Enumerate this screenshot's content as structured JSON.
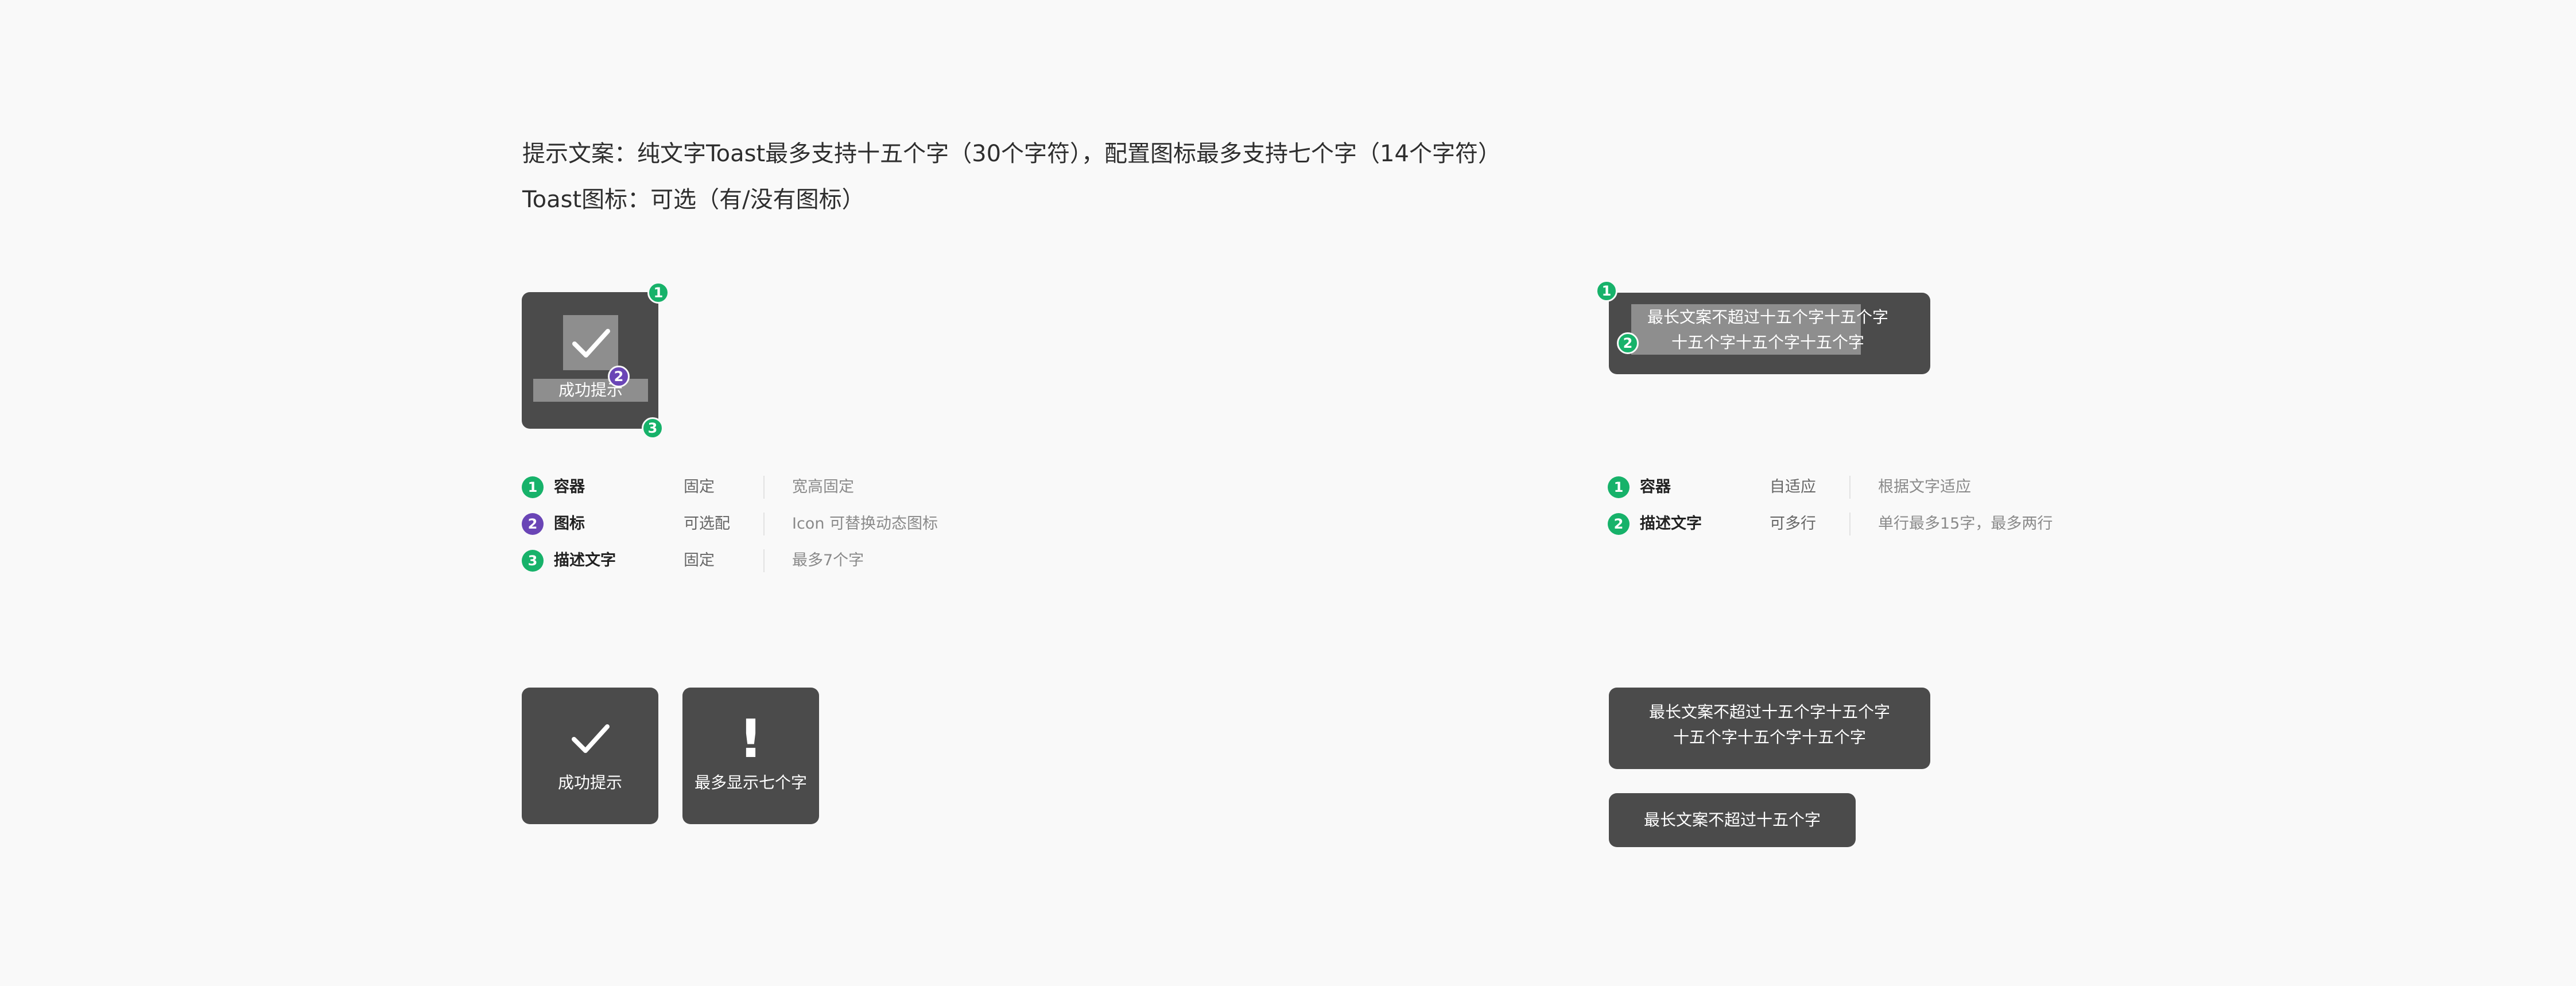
{
  "header": {
    "line1": "提示文案：纯文字Toast最多支持十五个字（30个字符），配置图标最多支持七个字（14个字符）",
    "line2": "Toast图标：可选（有/没有图标）"
  },
  "anatomy_icon_toast": {
    "label": "成功提示",
    "icon": "checkmark-icon",
    "badges": [
      "1",
      "2",
      "3"
    ]
  },
  "anatomy_text_toast": {
    "line1": "最长文案不超过十五个字十五个字",
    "line2": "十五个字十五个字十五个字",
    "badges": [
      "1",
      "2"
    ]
  },
  "spec_icon_toast": [
    {
      "num": "1",
      "name": "容器",
      "mode": "固定",
      "desc": "宽高固定",
      "badge_color": "#17b26a"
    },
    {
      "num": "2",
      "name": "图标",
      "mode": "可选配",
      "desc": "Icon 可替换动态图标",
      "badge_color": "#6a45b6"
    },
    {
      "num": "3",
      "name": "描述文字",
      "mode": "固定",
      "desc": "最多7个字",
      "badge_color": "#17b26a"
    }
  ],
  "spec_text_toast": [
    {
      "num": "1",
      "name": "容器",
      "mode": "自适应",
      "desc": "根据文字适应",
      "badge_color": "#17b26a"
    },
    {
      "num": "2",
      "name": "描述文字",
      "mode": "可多行",
      "desc": "单行最多15字，最多两行",
      "badge_color": "#17b26a"
    }
  ],
  "examples": {
    "success": {
      "label": "成功提示",
      "icon": "checkmark-icon"
    },
    "warning": {
      "label": "最多显示七个字",
      "icon": "exclamation-icon",
      "glyph": "!"
    },
    "two_line": {
      "line1": "最长文案不超过十五个字十五个字",
      "line2": "十五个字十五个字十五个字"
    },
    "one_line": {
      "text": "最长文案不超过十五个字"
    }
  },
  "colors": {
    "toast_bg": "#4b4b4b",
    "badge_green": "#17b26a",
    "badge_purple": "#6a45b6",
    "page_bg": "#f9f9f9"
  }
}
